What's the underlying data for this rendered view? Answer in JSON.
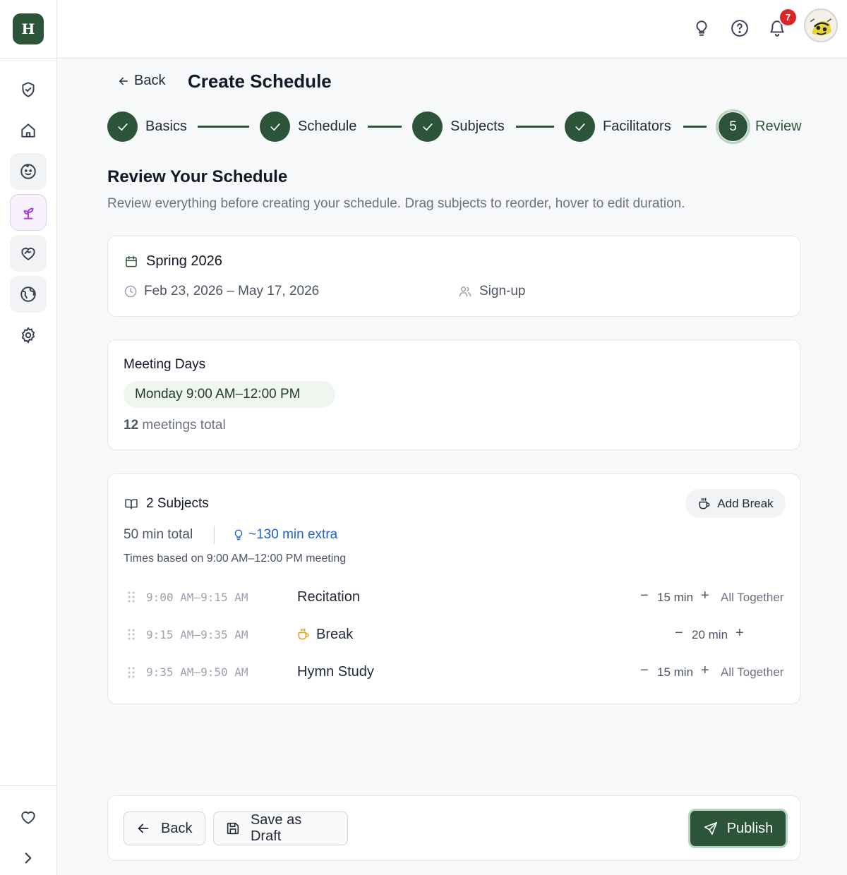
{
  "app": {
    "logo_letter": "H"
  },
  "sidebar": {
    "items": [
      {
        "icon": "shield-check-icon"
      },
      {
        "icon": "home-icon"
      },
      {
        "icon": "face-icon"
      },
      {
        "icon": "sprout-icon",
        "active": true
      },
      {
        "icon": "heart-handshake-icon"
      },
      {
        "icon": "globe-icon"
      },
      {
        "icon": "settings-icon"
      }
    ],
    "bottom": [
      {
        "icon": "heart-icon"
      },
      {
        "icon": "chevron-right-icon"
      }
    ]
  },
  "topbar": {
    "notification_count": "7"
  },
  "header": {
    "back_label": "Back",
    "title": "Create Schedule"
  },
  "stepper": {
    "steps": [
      {
        "label": "Basics",
        "state": "done"
      },
      {
        "label": "Schedule",
        "state": "done"
      },
      {
        "label": "Subjects",
        "state": "done"
      },
      {
        "label": "Facilitators",
        "state": "done"
      },
      {
        "label": "Review",
        "state": "current",
        "number": "5"
      }
    ]
  },
  "review": {
    "title": "Review Your Schedule",
    "description": "Review everything before creating your schedule. Drag subjects to reorder, hover to edit duration."
  },
  "term_card": {
    "name": "Spring 2026",
    "date_range": "Feb 23, 2026 – May 17, 2026",
    "enrollment": "Sign-up"
  },
  "meeting_card": {
    "title": "Meeting Days",
    "day_pill": "Monday 9:00 AM–12:00 PM",
    "total_count": "12",
    "total_label": "meetings total"
  },
  "subjects_card": {
    "title": "2 Subjects",
    "add_break_label": "Add Break",
    "total": "50 min total",
    "extra": "~130 min extra",
    "note": "Times based on 9:00 AM–12:00 PM meeting",
    "rows": [
      {
        "time": "9:00 AM–9:15 AM",
        "name": "Recitation",
        "duration": "15 min",
        "group": "All Together",
        "is_break": false
      },
      {
        "time": "9:15 AM–9:35 AM",
        "name": "Break",
        "duration": "20 min",
        "group": "",
        "is_break": true
      },
      {
        "time": "9:35 AM–9:50 AM",
        "name": "Hymn Study",
        "duration": "15 min",
        "group": "All Together",
        "is_break": false
      }
    ],
    "minus_symbol": "−",
    "plus_symbol": "+"
  },
  "footer": {
    "back_label": "Back",
    "draft_label": "Save as Draft",
    "publish_label": "Publish"
  },
  "colors": {
    "brand": "#2b5438",
    "accent_purple": "#a33cd6",
    "link_blue": "#1d5fd6",
    "break_orange": "#e69a12",
    "badge_red": "#dc2626"
  }
}
